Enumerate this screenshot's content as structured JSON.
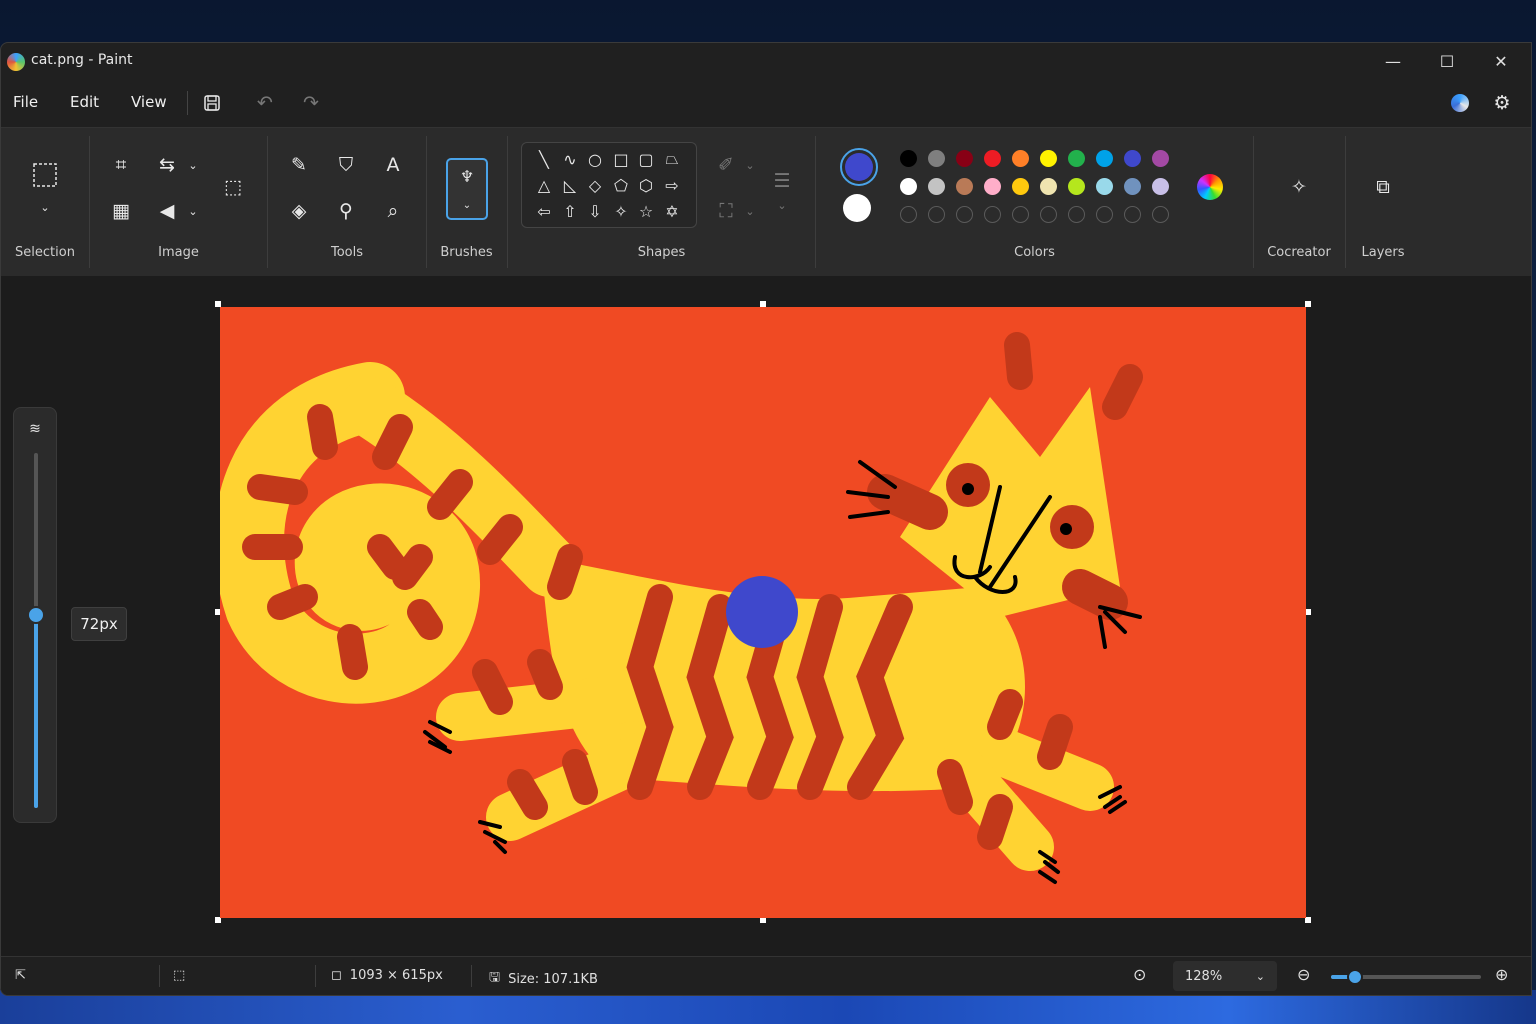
{
  "window": {
    "title": "cat.png - Paint",
    "minimize": "—",
    "maximize": "☐",
    "close": "✕"
  },
  "menu": {
    "file": "File",
    "edit": "Edit",
    "view": "View"
  },
  "ribbon": {
    "selection_label": "Selection",
    "image_label": "Image",
    "tools_label": "Tools",
    "brushes_label": "Brushes",
    "shapes_label": "Shapes",
    "colors_label": "Colors",
    "cocreator_label": "Cocreator",
    "layers_label": "Layers"
  },
  "colors": {
    "primary": "#3f48cc",
    "secondary": "#ffffff",
    "row1": [
      "#000000",
      "#7f7f7f",
      "#880015",
      "#ed1c24",
      "#ff7f27",
      "#fff200",
      "#22b14c",
      "#00a2e8",
      "#3f48cc",
      "#a349a4"
    ],
    "row2": [
      "#ffffff",
      "#c3c3c3",
      "#b97a57",
      "#ffaec9",
      "#ffc90e",
      "#efe4b0",
      "#b5e61d",
      "#99d9ea",
      "#7092be",
      "#c8bfe7"
    ]
  },
  "brush_size": {
    "tooltip": "72px",
    "level_fraction": 0.55
  },
  "status": {
    "canvas_size": "1093 × 615px",
    "file_size": "Size: 107.1KB",
    "zoom": "128%",
    "zoom_fraction": 0.15
  }
}
